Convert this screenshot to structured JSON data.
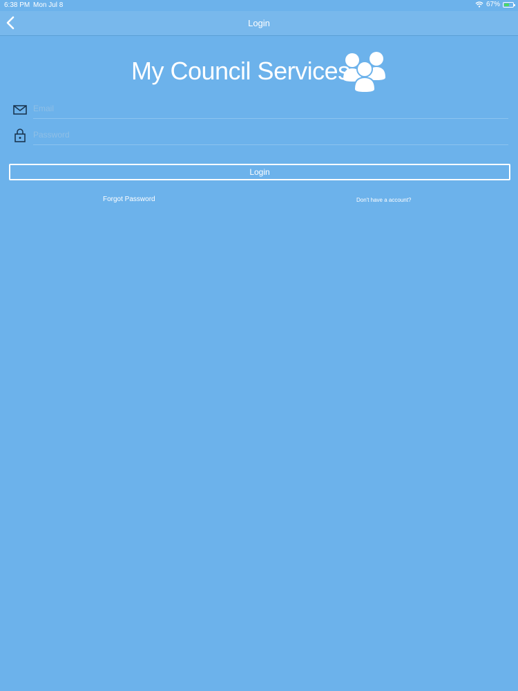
{
  "status_bar": {
    "time": "6:38 PM",
    "date": "Mon Jul 8",
    "battery": "67%",
    "battery_level": 0.67,
    "wifi_icon": "wifi-icon",
    "battery_icon": "battery-charging-icon"
  },
  "nav": {
    "title": "Login",
    "back_icon": "chevron-left-icon"
  },
  "brand": {
    "title": "My Council Services",
    "logo_icon": "people-group-icon"
  },
  "form": {
    "email": {
      "placeholder": "Email",
      "value": "",
      "icon": "envelope-icon"
    },
    "password": {
      "placeholder": "Password",
      "value": "",
      "icon": "lock-icon"
    },
    "login_label": "Login"
  },
  "links": {
    "forgot_password": "Forgot Password",
    "no_account": "Don't have a account?"
  },
  "colors": {
    "background": "#6cb2eb",
    "nav_background": "#78b8ec",
    "text": "#ffffff",
    "placeholder": "#8fbfe6",
    "battery_fill": "#4cd964"
  }
}
